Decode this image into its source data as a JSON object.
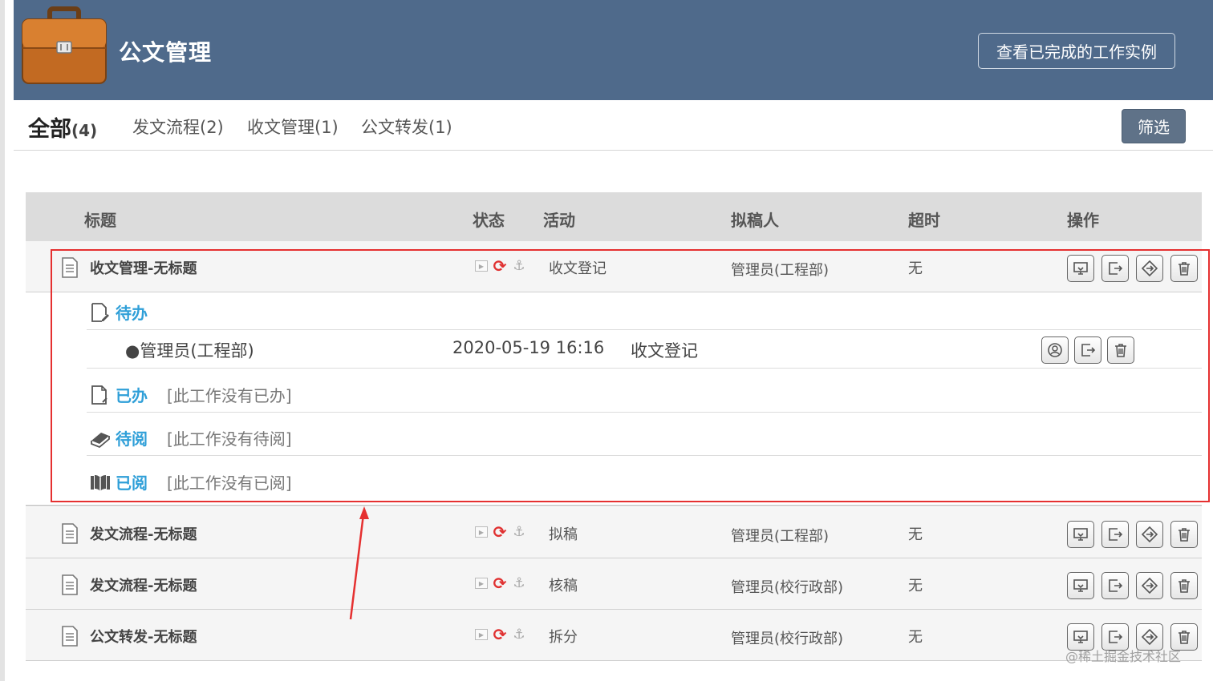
{
  "header": {
    "app_title": "公文管理",
    "completed_button": "查看已完成的工作实例",
    "icon": "briefcase-icon",
    "bg_color": "#4f6a8b"
  },
  "tabs": {
    "all_label": "全部",
    "all_count": "(4)",
    "items": [
      {
        "label": "发文流程(2)"
      },
      {
        "label": "收文管理(1)"
      },
      {
        "label": "公文转发(1)"
      }
    ],
    "filter_button": "筛选"
  },
  "table": {
    "headers": {
      "title": "标题",
      "status": "状态",
      "activity": "活动",
      "drafter": "拟稿人",
      "overtime": "超时",
      "actions": "操作"
    },
    "rows": [
      {
        "title": "收文管理-无标题",
        "activity": "收文登记",
        "drafter": "管理员(工程部)",
        "overtime": "无"
      },
      {
        "title": "发文流程-无标题",
        "activity": "拟稿",
        "drafter": "管理员(工程部)",
        "overtime": "无"
      },
      {
        "title": "发文流程-无标题",
        "activity": "核稿",
        "drafter": "管理员(校行政部)",
        "overtime": "无"
      },
      {
        "title": "公文转发-无标题",
        "activity": "拆分",
        "drafter": "管理员(校行政部)",
        "overtime": "无"
      }
    ]
  },
  "detail": {
    "todo_label": "待办",
    "todo_item": {
      "person": "管理员(工程部)",
      "time": "2020-05-19 16:16",
      "activity": "收文登记"
    },
    "done_label": "已办",
    "done_empty": "[此工作没有已办]",
    "to_read_label": "待阅",
    "to_read_empty": "[此工作没有待阅]",
    "read_label": "已阅",
    "read_empty": "[此工作没有已阅]"
  },
  "watermark": "@稀土掘金技术社区",
  "colors": {
    "accent_blue": "#2f9fd8",
    "highlight_red": "#e53030",
    "filter_button": "#5f7288"
  }
}
